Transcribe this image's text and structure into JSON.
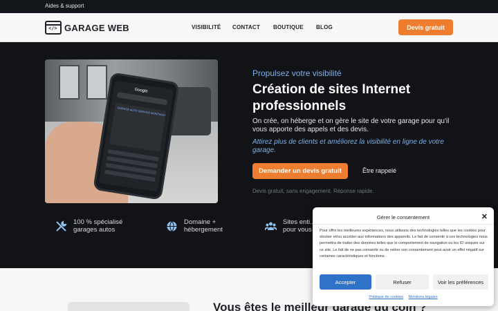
{
  "topbar": {
    "support_link": "Aides & support"
  },
  "header": {
    "logo_text": "GARAGE WEB",
    "logo_glyph": "</>",
    "menu": [
      {
        "label": "VISIBILITÉ"
      },
      {
        "label": "CONTACT"
      },
      {
        "label": "BOUTIQUE"
      },
      {
        "label": "BLOG"
      }
    ],
    "cta_label": "Devis gratuit"
  },
  "hero": {
    "eyebrow": "Propulsez votre visibilité",
    "title": "Création de sites Internet professionnels",
    "lead": "On crée, on héberge et on gère le site de votre garage pour qu'il vous apporte des appels et des devis.",
    "tagline": "Attirez plus de clients et améliorez la visibilité en ligne de votre garage.",
    "cta_label": "Demander un devis gratuit",
    "callback_label": "Être rappelé",
    "note": "Devis gratuit, sans engagement. Réponse rapide.",
    "phone_brand": "Google",
    "phone_result_title": "GARAGE AUTO SERVICE MONTIGNY"
  },
  "features": [
    {
      "icon": "wrench-icon",
      "text": "100 % spécialisé garages autos"
    },
    {
      "icon": "globe-icon",
      "text": "Domaine + hébergement"
    },
    {
      "icon": "users-icon",
      "text": "Sites enti... pour vous"
    }
  ],
  "section2": {
    "heading": "Vous êtes le meilleur garage du coin ?"
  },
  "consent": {
    "title": "Gérer le consentement",
    "body": "Pour offrir les meilleures expériences, nous utilisons des technologies telles que les cookies pour stocker et/ou accéder aux informations des appareils. Le fait de consentir à ces technologies nous permettra de traiter des données telles que le comportement de navigation ou les ID uniques sur ce site. Le fait de ne pas consentir ou de retirer son consentement peut avoir un effet négatif sur certaines caractéristiques et fonctions.",
    "accept_label": "Accepter",
    "refuse_label": "Refuser",
    "prefs_label": "Voir les préférences",
    "links": [
      "Politique de cookies",
      "Mentions légales"
    ]
  },
  "colors": {
    "accent": "#ef7d2f",
    "link_blue": "#7fb0e8",
    "primary_button": "#2f73c9",
    "dark_bg": "#111317"
  }
}
